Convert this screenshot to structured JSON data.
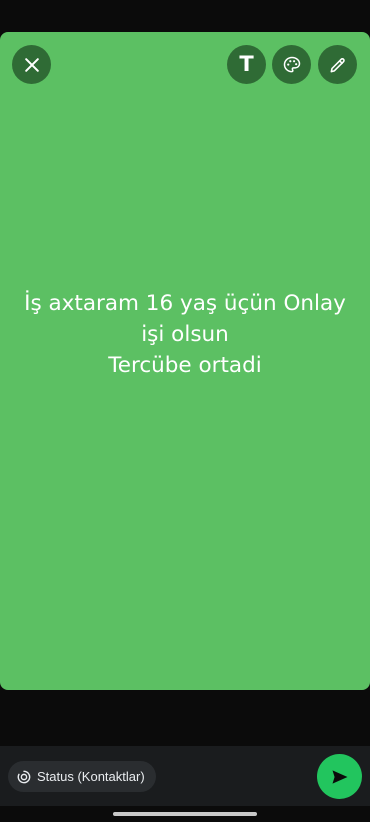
{
  "toolbar": {
    "close_icon": "close-icon",
    "text_tool_glyph": "T",
    "palette_icon": "palette-icon",
    "pen_icon": "pen-icon"
  },
  "status": {
    "text": "İş axtaram 16 yaş üçün Onlay işi olsun\nTercübe ortadi",
    "background_color": "#5cc063"
  },
  "footer": {
    "audience_label": "Status (Kontaktlar)",
    "send_icon": "send-icon",
    "accent_color": "#22c55e"
  }
}
